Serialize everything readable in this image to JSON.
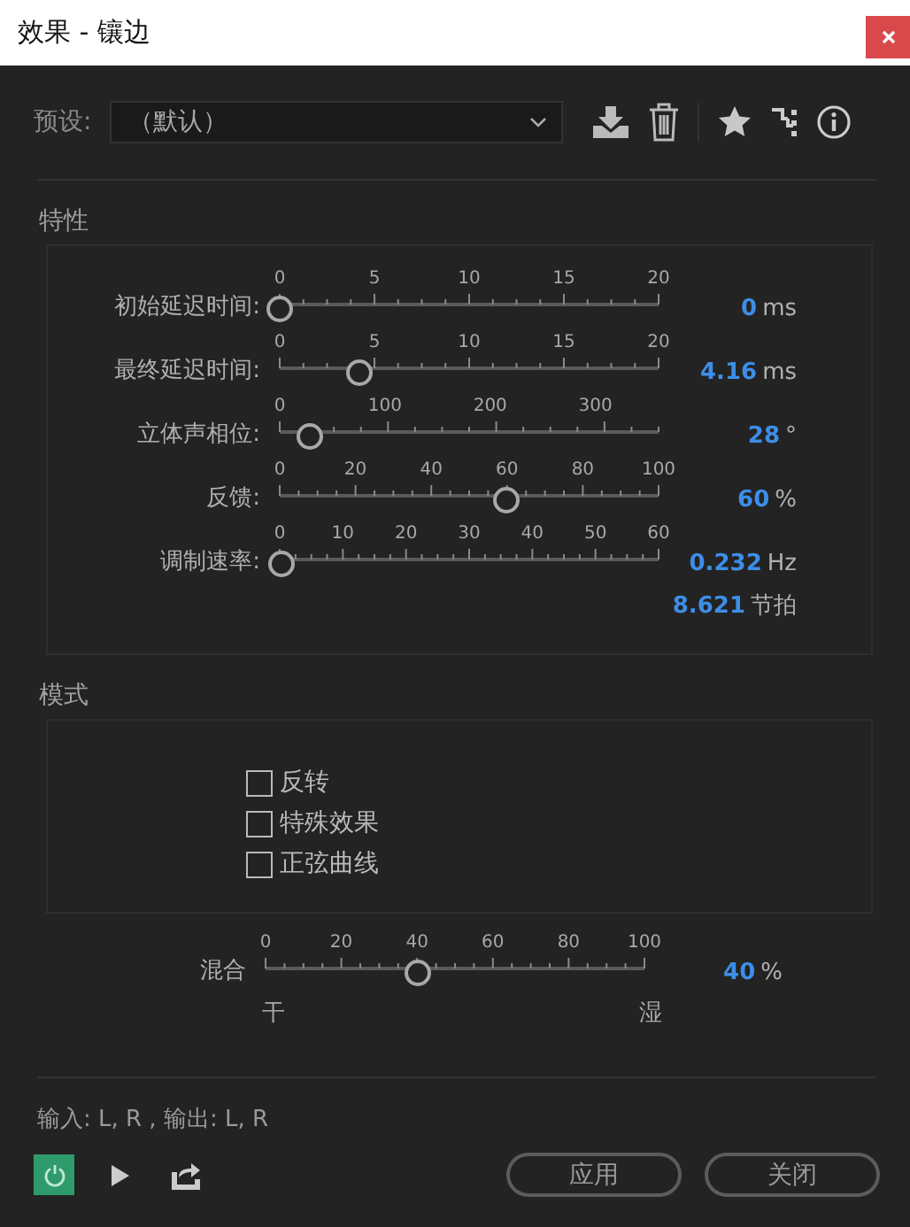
{
  "window": {
    "title": "效果 - 镶边"
  },
  "preset": {
    "label": "预设:",
    "value": "（默认）"
  },
  "properties": {
    "title": "特性",
    "sliders": [
      {
        "label": "初始延迟时间:",
        "ticks": [
          "0",
          "5",
          "10",
          "15",
          "20"
        ],
        "kind": "closed",
        "level": 0,
        "value": "0",
        "unit": "ms"
      },
      {
        "label": "最终延迟时间:",
        "ticks": [
          "0",
          "5",
          "10",
          "15",
          "20"
        ],
        "kind": "closed",
        "level": 0.208,
        "value": "4.16",
        "unit": "ms"
      },
      {
        "label": "立体声相位:",
        "ticks": [
          "0",
          "100",
          "200",
          "300"
        ],
        "kind": "open",
        "level": 0.078,
        "value": "28",
        "unit": "°"
      },
      {
        "label": "反馈:",
        "ticks": [
          "0",
          "20",
          "40",
          "60",
          "80",
          "100"
        ],
        "kind": "closed",
        "level": 0.6,
        "value": "60",
        "unit": "%"
      },
      {
        "label": "调制速率:",
        "ticks": [
          "0",
          "10",
          "20",
          "30",
          "40",
          "50",
          "60"
        ],
        "kind": "closed",
        "level": 0.004,
        "value": "0.232",
        "unit": "Hz"
      }
    ],
    "beats": {
      "value": "8.621",
      "unit": "节拍"
    }
  },
  "mode": {
    "title": "模式",
    "options": [
      {
        "label": "反转",
        "checked": false
      },
      {
        "label": "特殊效果",
        "checked": false
      },
      {
        "label": "正弦曲线",
        "checked": false
      }
    ]
  },
  "mix": {
    "label": "混合",
    "ticks": [
      "0",
      "20",
      "40",
      "60",
      "80",
      "100"
    ],
    "level": 0.4,
    "value": "40",
    "unit": "%",
    "left": "干",
    "right": "湿"
  },
  "io": "输入: L, R , 输出: L, R",
  "power": {
    "on": true
  },
  "buttons": [
    "应用",
    "关闭"
  ]
}
